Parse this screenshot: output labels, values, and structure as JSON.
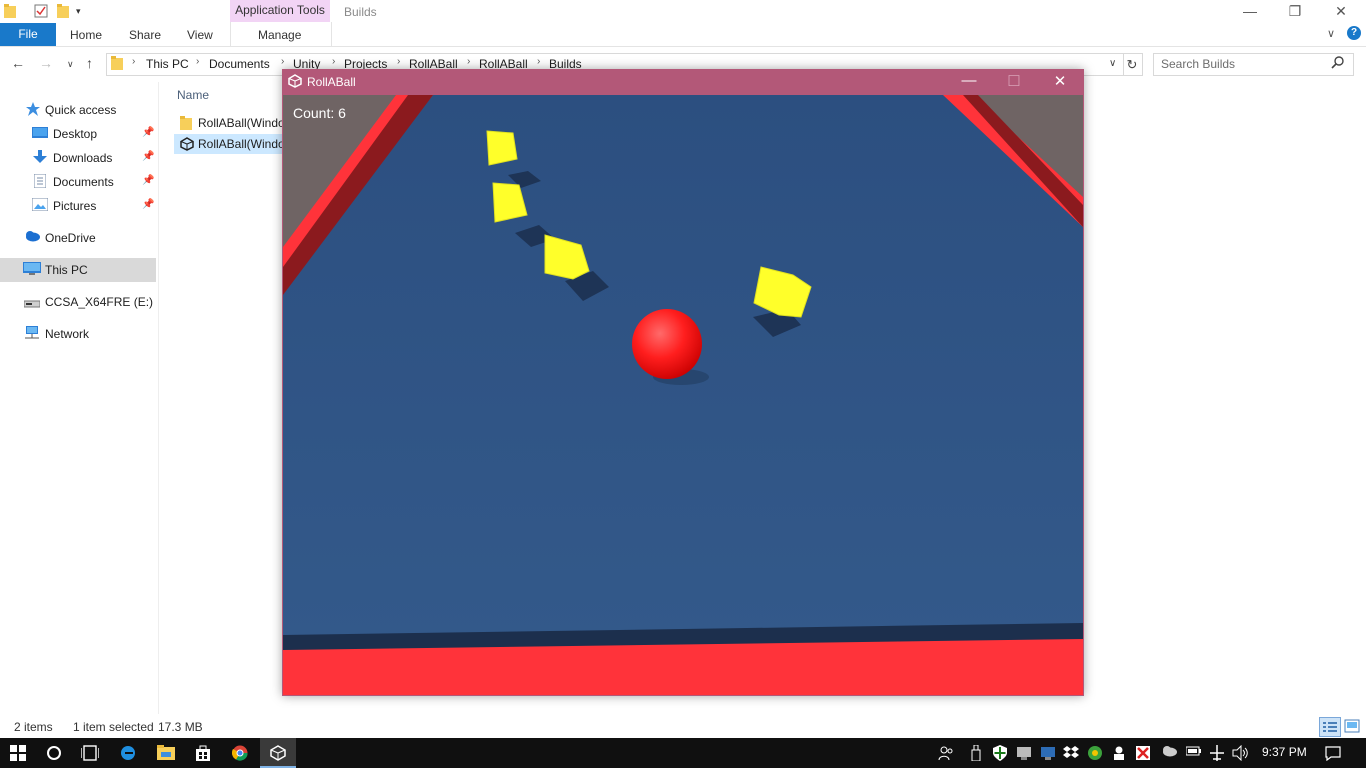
{
  "explorer": {
    "ribbon": {
      "context_group": "Application Tools",
      "window_title": "Builds",
      "tabs": [
        "File",
        "Home",
        "Share",
        "View",
        "Manage"
      ]
    },
    "address": {
      "crumbs": [
        "This PC",
        "Documents",
        "Unity",
        "Projects",
        "RollABall",
        "RollABall",
        "Builds"
      ],
      "search_placeholder": "Search Builds"
    },
    "nav_pane": {
      "items": [
        {
          "label": "Quick access",
          "icon": "star-icon"
        },
        {
          "label": "Desktop",
          "icon": "desktop-icon",
          "pinned": true
        },
        {
          "label": "Downloads",
          "icon": "download-icon",
          "pinned": true
        },
        {
          "label": "Documents",
          "icon": "documents-icon",
          "pinned": true
        },
        {
          "label": "Pictures",
          "icon": "pictures-icon",
          "pinned": true
        },
        {
          "label": "OneDrive",
          "icon": "cloud-icon"
        },
        {
          "label": "This PC",
          "icon": "computer-icon",
          "selected": true
        },
        {
          "label": "CCSA_X64FRE (E:)",
          "icon": "drive-icon"
        },
        {
          "label": "Network",
          "icon": "network-icon"
        }
      ]
    },
    "file_list": {
      "column_name": "Name",
      "files": [
        {
          "label": "RollABall(Windo",
          "icon": "folder-icon"
        },
        {
          "label": "RollABall(Windo",
          "icon": "unity-icon",
          "selected": true
        }
      ]
    },
    "status": {
      "items_count": "2 items",
      "selection": "1 item selected",
      "size": "17.3 MB"
    }
  },
  "game": {
    "title": "RollABall",
    "count_label": "Count: 6"
  },
  "taskbar": {
    "clock": "9:37 PM"
  },
  "colors": {
    "accent_blue": "#1979ca",
    "game_titlebar": "#b35878",
    "game_floor": "#2f5585",
    "wall_red": "#ff3038",
    "pickup_yellow": "#ffff2a",
    "player_red": "#ff2020"
  }
}
